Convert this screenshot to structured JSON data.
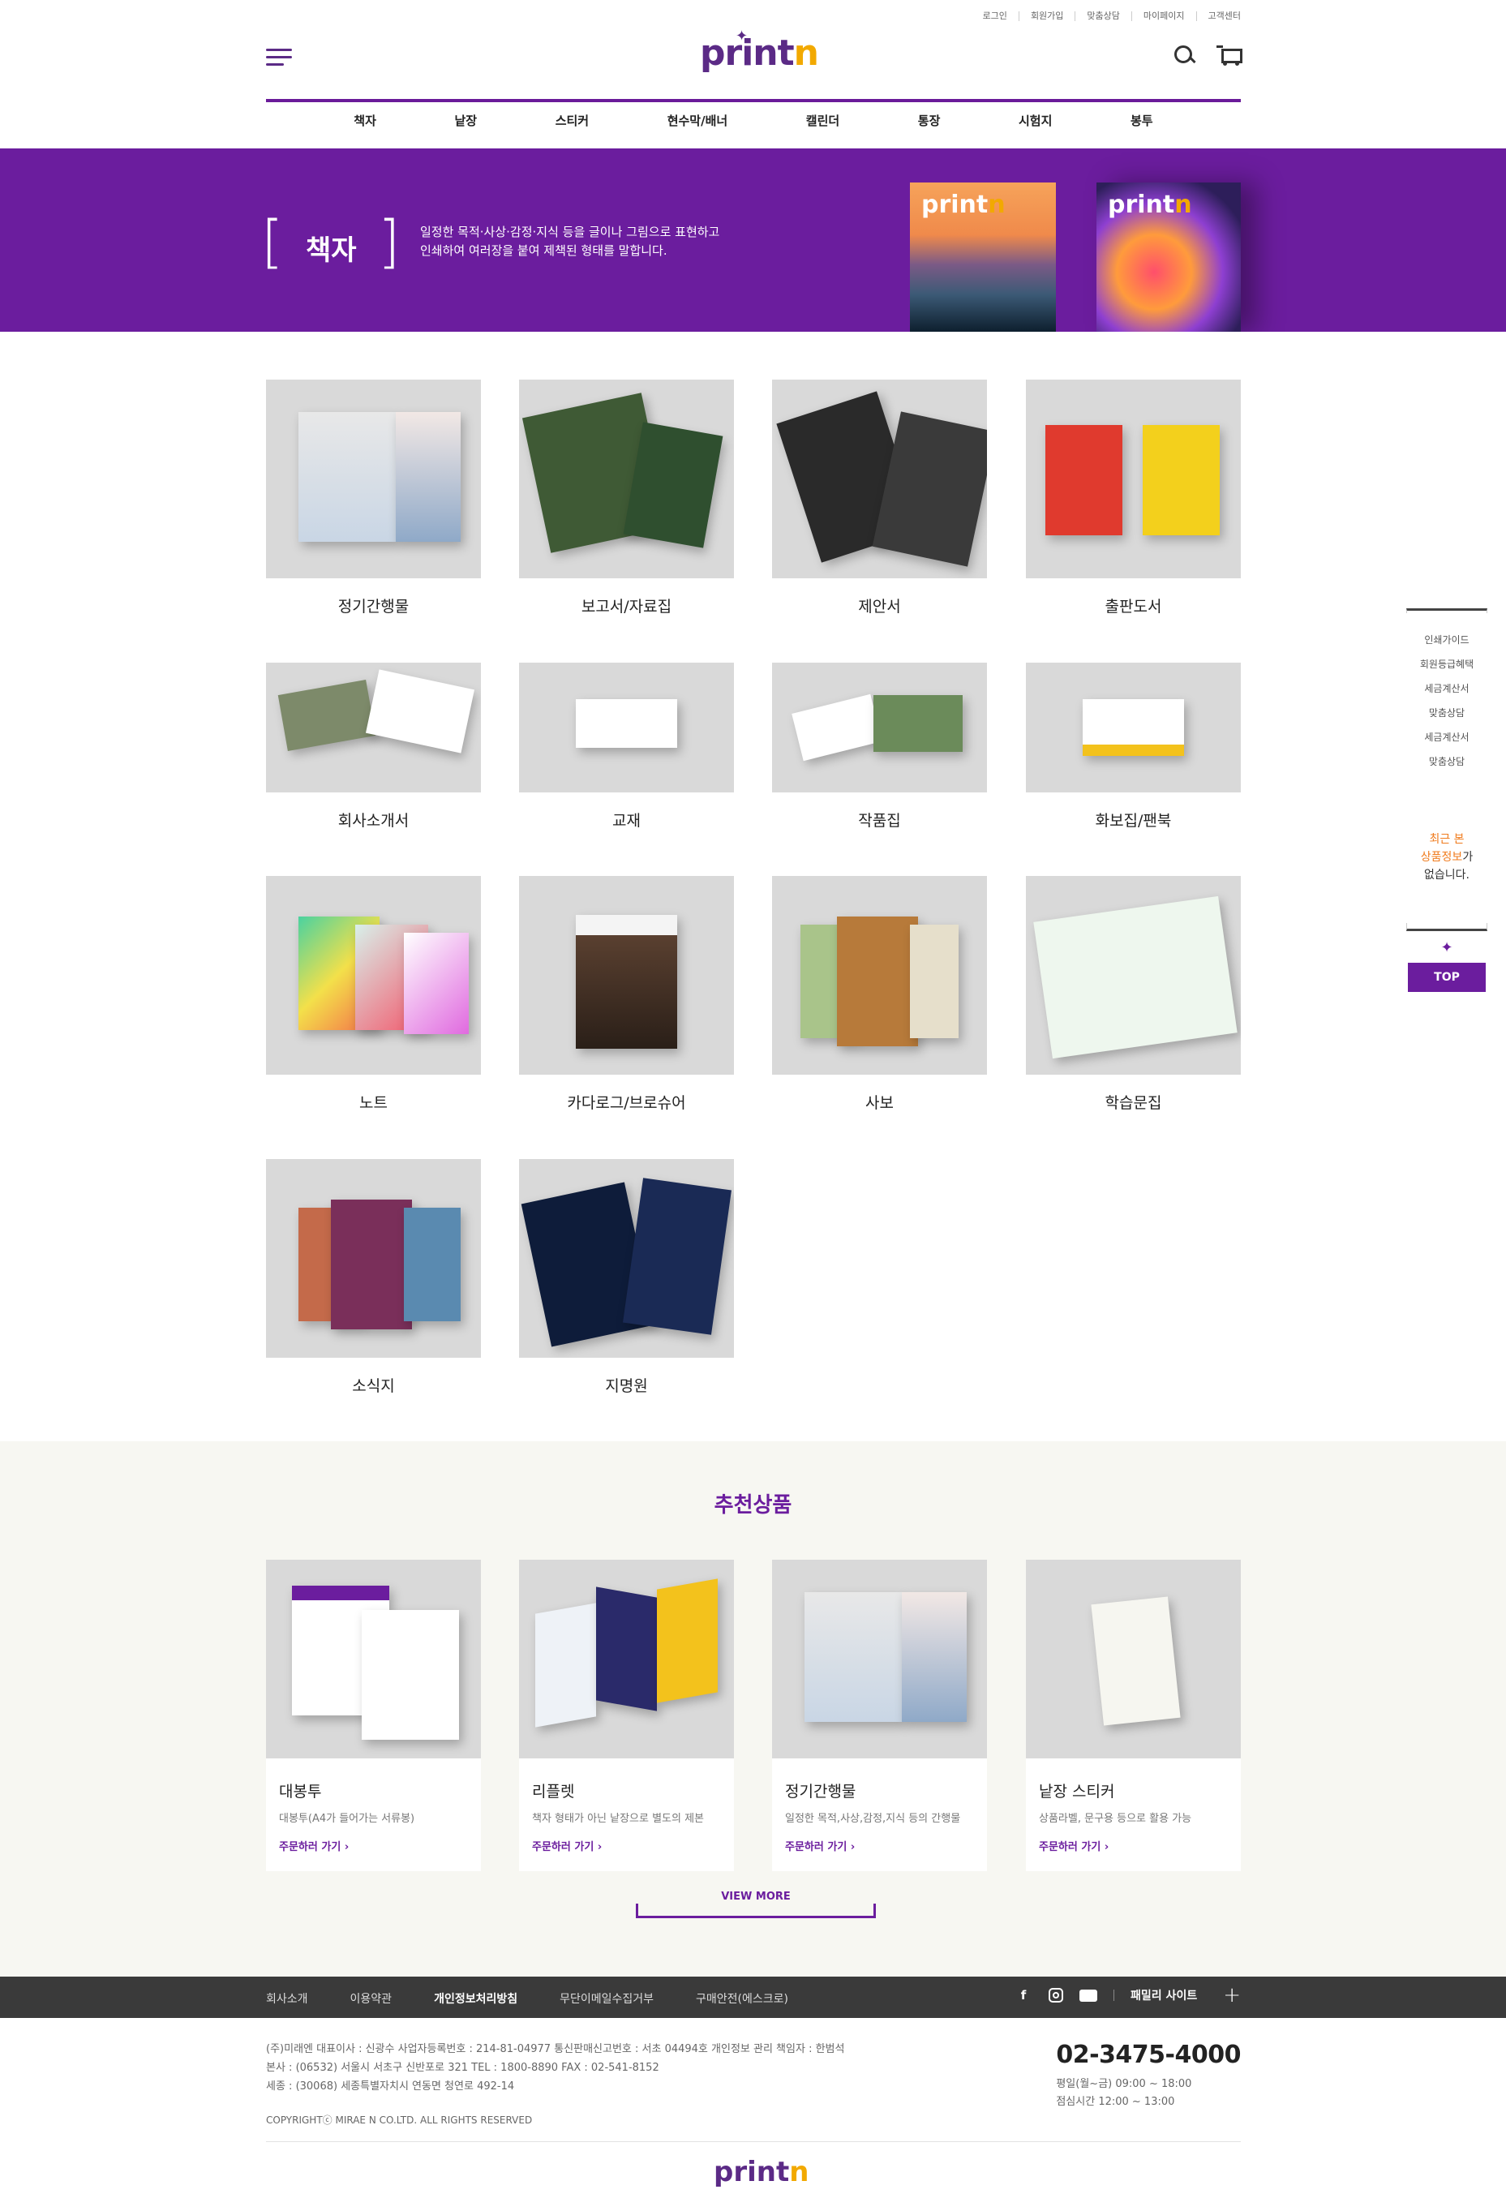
{
  "util_links": [
    "로그인",
    "회원가입",
    "맞춤상담",
    "마이페이지",
    "고객센터"
  ],
  "logo": {
    "main": "print",
    "accent": "n"
  },
  "nav": [
    "책자",
    "낱장",
    "스티커",
    "현수막/배너",
    "캘린더",
    "통장",
    "시험지",
    "봉투"
  ],
  "banner": {
    "title": "책자",
    "bracket_open": "[",
    "bracket_close": "]",
    "desc_line1": "일정한 목적·사상·감정·지식 등을 글이나 그림으로 표현하고",
    "desc_line2": "인쇄하여 여러장을 붙여 제책된 형태를 말합니다."
  },
  "products": [
    "정기간행물",
    "보고서/자료집",
    "제안서",
    "출판도서",
    "회사소개서",
    "교재",
    "작품집",
    "화보집/팬북",
    "노트",
    "카다로그/브로슈어",
    "사보",
    "학습문집",
    "소식지",
    "지명원"
  ],
  "side_menu": {
    "links": [
      "인쇄가이드",
      "회원등급혜택",
      "세금계산서",
      "맞춤상담",
      "세금계산서",
      "맞춤상담"
    ],
    "recent_line1": "최근 본",
    "recent_hl": "상품정보",
    "recent_tail": "가",
    "recent_line3": "없습니다.",
    "top": "TOP"
  },
  "reco": {
    "title": "추천상품",
    "view_more": "VIEW MORE",
    "items": [
      {
        "name": "대봉투",
        "sub": "대봉투(A4가 들어가는 서류봉)",
        "go": "주문하러 가기"
      },
      {
        "name": "리플렛",
        "sub": "책자 형태가 아닌 낱장으로 별도의 제본",
        "go": "주문하러 가기"
      },
      {
        "name": "정기간행물",
        "sub": "일정한 목적,사상,감정,지식 등의 간행물",
        "go": "주문하러 가기"
      },
      {
        "name": "낱장 스티커",
        "sub": "상품라벨, 문구용 등으로 활용 가능",
        "go": "주문하러 가기"
      }
    ]
  },
  "footer": {
    "links": [
      "회사소개",
      "이용약관",
      "개인정보처리방침",
      "무단이메일수집거부",
      "구매안전(에스크로)"
    ],
    "family": "패밀리 사이트",
    "info1": "(주)미래엔 대표이사 : 신광수 사업자등록번호 : 214-81-04977 통신판매신고번호 : 서초 04494호 개인정보 관리 책임자 : 한범석",
    "info2": "본사 : (06532) 서울시 서초구 신반포로 321 TEL : 1800-8890 FAX : 02-541-8152",
    "info3": "세종 : (30068) 세종특별자치시 연동면 청연로 492-14",
    "copyright": "COPYRIGHTⓒ MIRAE N CO.LTD. ALL RIGHTS RESERVED",
    "phone": "02-3475-4000",
    "hours1": "평일(월~금) 09:00 ~ 18:00",
    "hours2": "점심시간 12:00 ~ 13:00"
  },
  "colors": {
    "brand": "#6b1d9e",
    "accent": "#f2a900",
    "footer_bar": "#3a3a3a"
  }
}
